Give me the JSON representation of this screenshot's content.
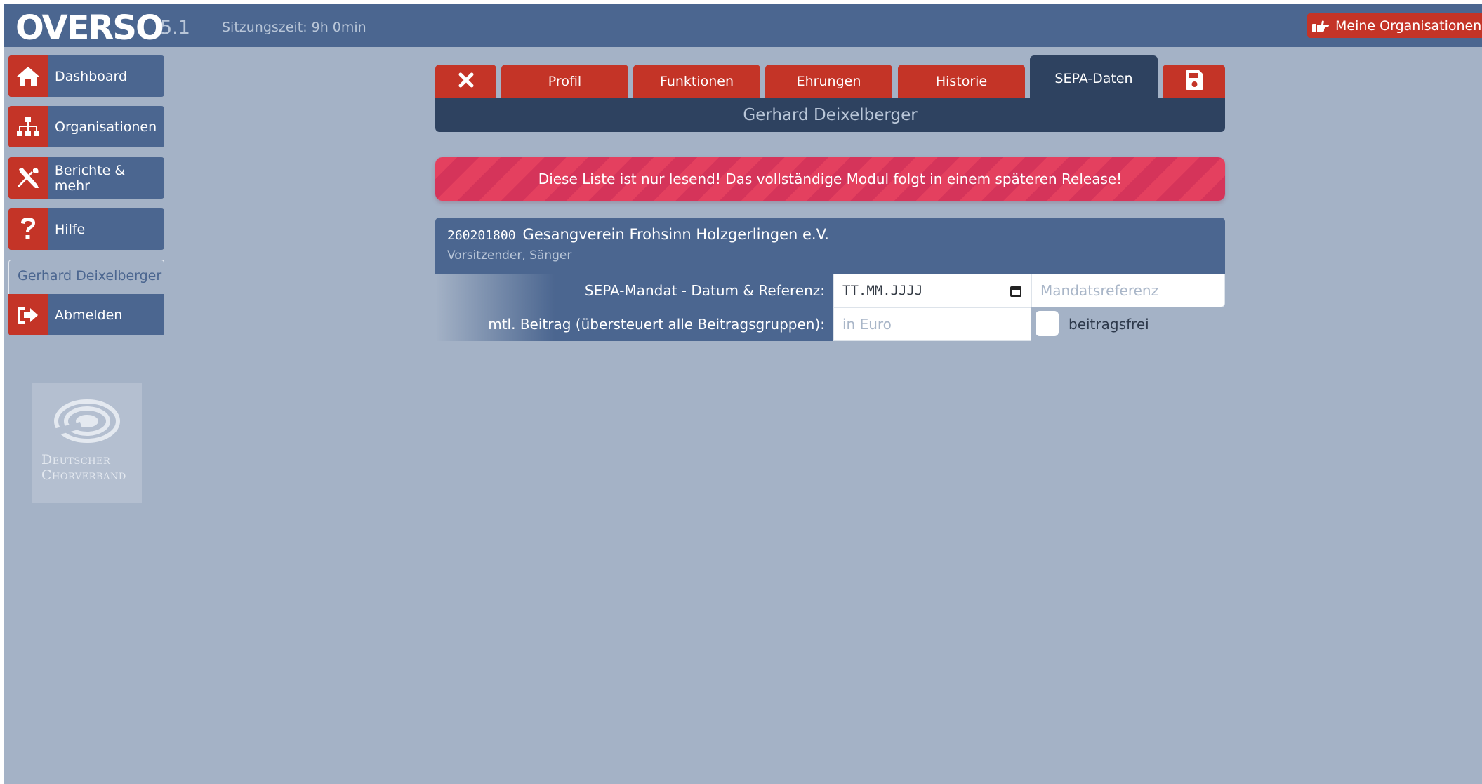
{
  "header": {
    "logo": "OVERSO",
    "version": "5.1",
    "session": "Sitzungszeit: 9h 0min",
    "orgs_button": "Meine Organisationen"
  },
  "sidebar": {
    "items": [
      {
        "label": "Dashboard",
        "icon": "home-icon"
      },
      {
        "label": "Organisationen",
        "icon": "sitemap-icon"
      },
      {
        "label": "Berichte & mehr",
        "icon": "tools-icon"
      },
      {
        "label": "Hilfe",
        "icon": "question-icon"
      }
    ],
    "user_name": "Gerhard Deixelberger",
    "logout_label": "Abmelden",
    "brand_logo_text": [
      "Deutscher",
      "Chorverband"
    ]
  },
  "tabs": [
    {
      "label": "Profil"
    },
    {
      "label": "Funktionen"
    },
    {
      "label": "Ehrungen"
    },
    {
      "label": "Historie"
    },
    {
      "label": "SEPA-Daten",
      "active": true
    }
  ],
  "person_name": "Gerhard Deixelberger",
  "warning": "Diese Liste ist nur lesend! Das vollständige Modul folgt in einem späteren Release!",
  "membership": {
    "org_id": "260201800",
    "org_name": "Gesangverein Frohsinn Holzgerlingen e.V.",
    "roles": "Vorsitzender, Sänger",
    "sepa_label": "SEPA-Mandat - Datum & Referenz:",
    "date_value": "TT.MM.JJJJ",
    "reference_placeholder": "Mandatsreferenz",
    "fee_label": "mtl. Beitrag (übersteuert alle Beitragsgruppen):",
    "fee_placeholder": "in Euro",
    "free_label": "beitragsfrei"
  },
  "colors": {
    "accent_red": "#c43427",
    "nav_blue": "#4b6690",
    "dark_blue": "#2e4260",
    "background": "#a4b2c6",
    "warning_pink": "#e4405f"
  }
}
